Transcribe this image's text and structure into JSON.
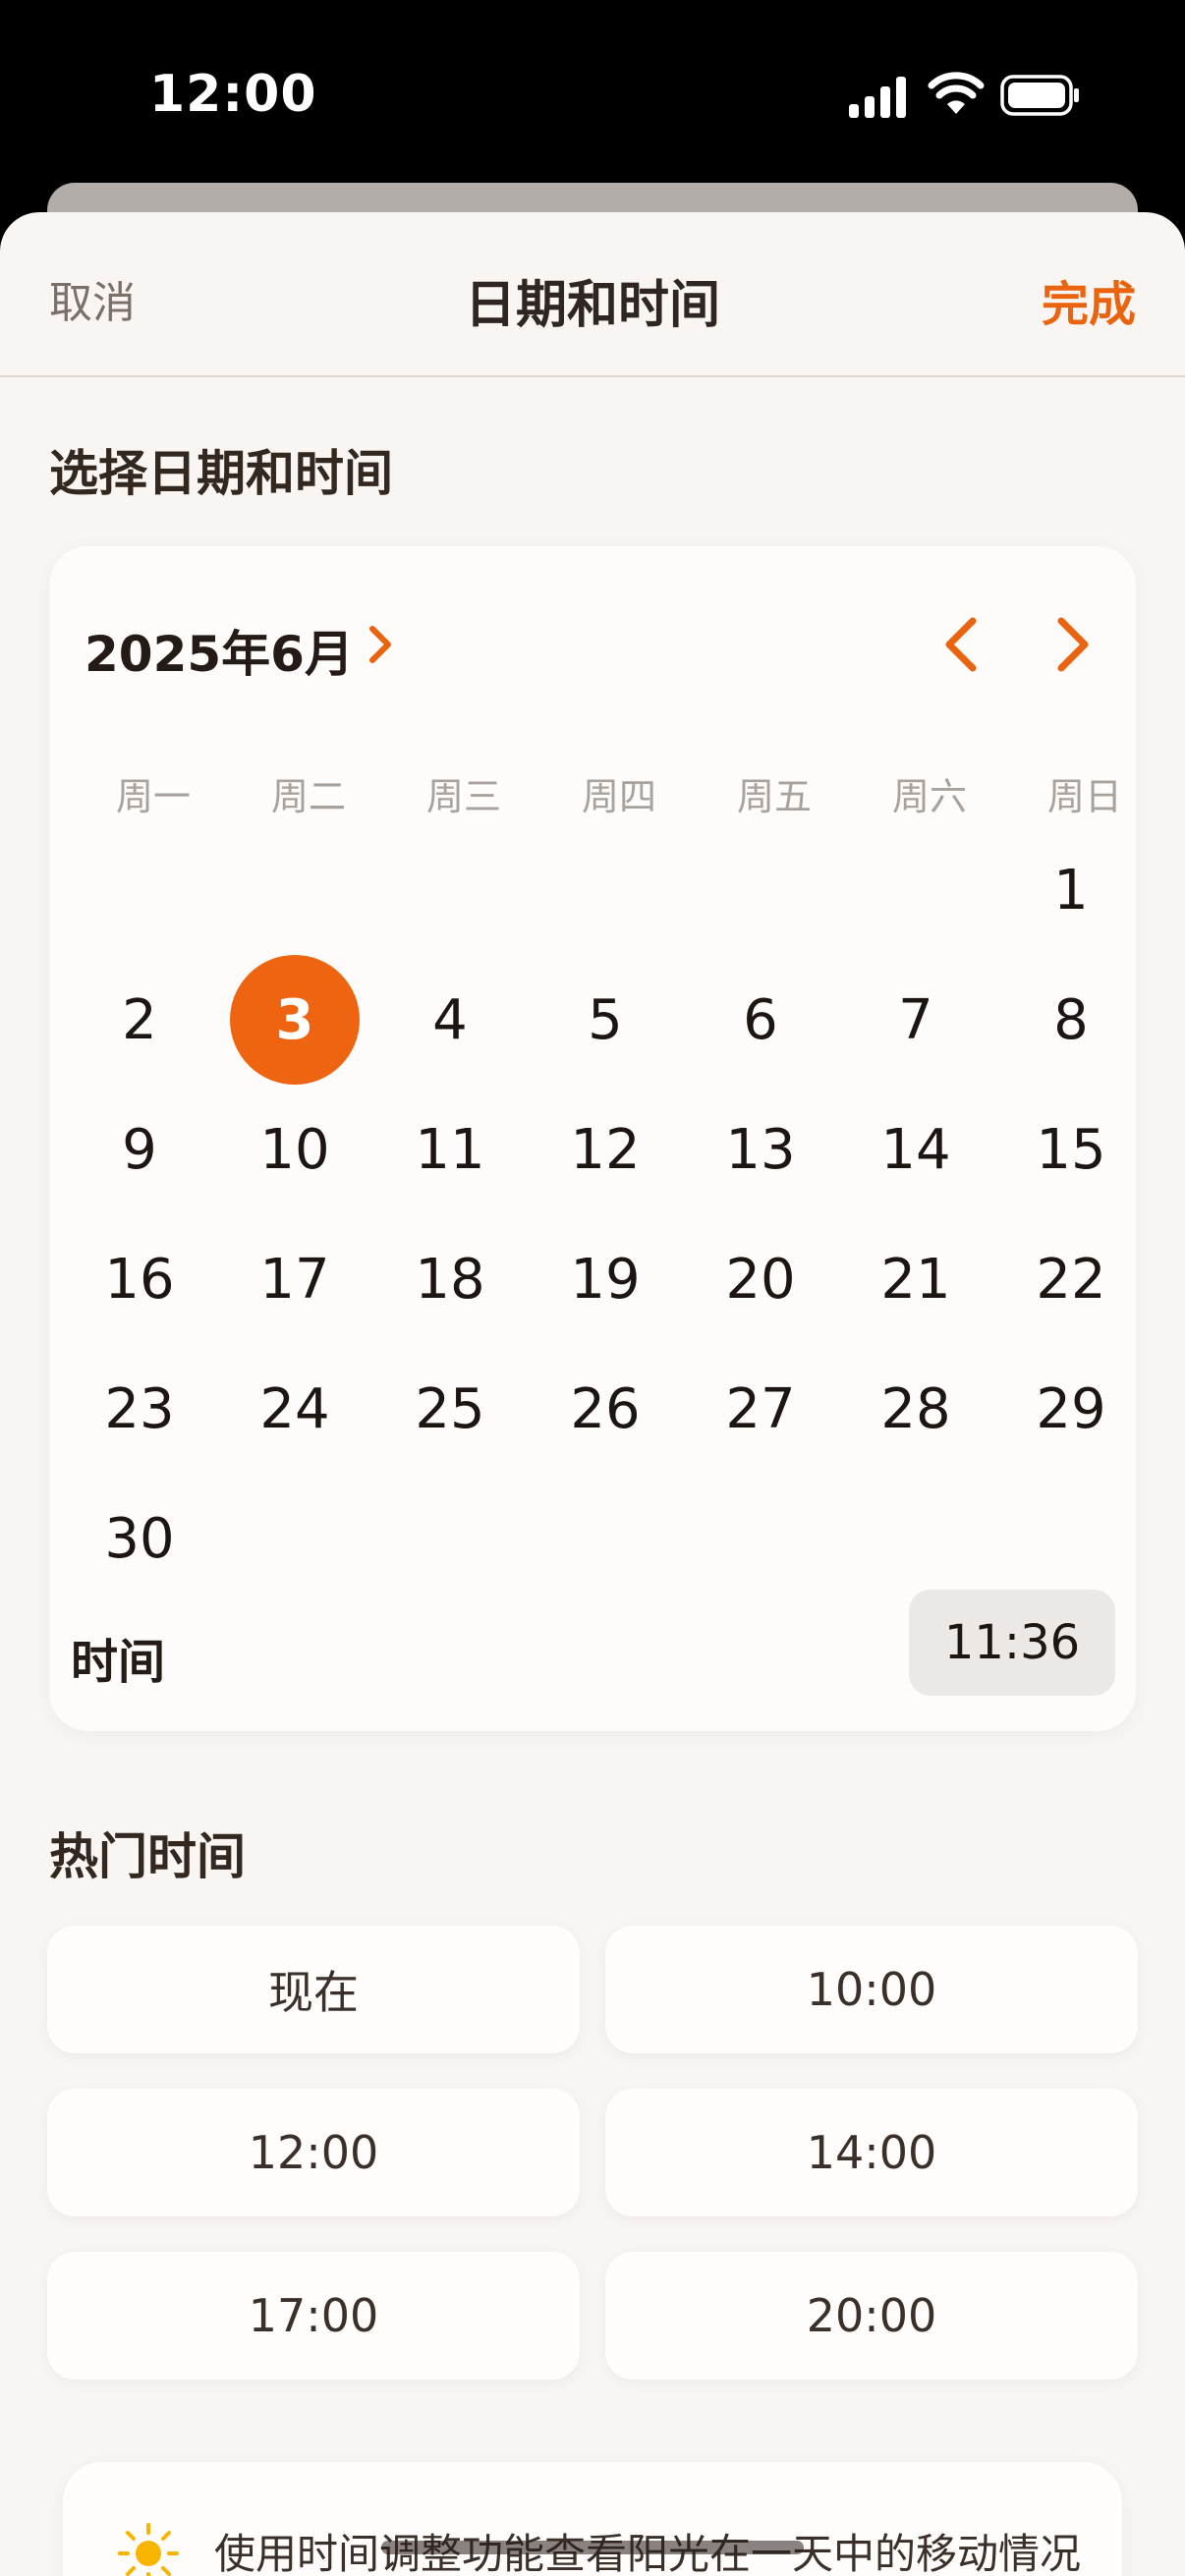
{
  "status_bar": {
    "time": "12:00"
  },
  "nav": {
    "cancel": "取消",
    "title": "日期和时间",
    "done": "完成"
  },
  "section_select": "选择日期和时间",
  "calendar": {
    "month_label": "2025年6月",
    "weekdays": [
      "周一",
      "周二",
      "周三",
      "周四",
      "周五",
      "周六",
      "周日"
    ],
    "days": [
      "1",
      "2",
      "3",
      "4",
      "5",
      "6",
      "7",
      "8",
      "9",
      "10",
      "11",
      "12",
      "13",
      "14",
      "15",
      "16",
      "17",
      "18",
      "19",
      "20",
      "21",
      "22",
      "23",
      "24",
      "25",
      "26",
      "27",
      "28",
      "29",
      "30"
    ],
    "first_weekday_index": 6,
    "selected_day": "3"
  },
  "time": {
    "label": "时间",
    "value": "11:36"
  },
  "section_popular": "热门时间",
  "presets": [
    "现在",
    "10:00",
    "12:00",
    "14:00",
    "17:00",
    "20:00"
  ],
  "tip": {
    "text": "使用时间调整功能查看阳光在一天中的移动情况"
  },
  "colors": {
    "accent": "#EA6410",
    "background": "#F8F5F3",
    "card": "#FDFCFB"
  },
  "icons": {
    "month": "chevron-right-icon",
    "prev": "chevron-left-icon",
    "next": "chevron-right-icon",
    "tip": "sun-icon"
  }
}
